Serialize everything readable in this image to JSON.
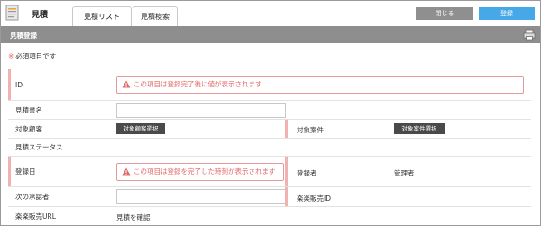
{
  "header": {
    "app_title": "見積",
    "tabs": [
      {
        "label": "見積リスト"
      },
      {
        "label": "見積検索"
      }
    ],
    "close_label": "閉じる",
    "register_label": "登録"
  },
  "section": {
    "title": "見積登録"
  },
  "required_note": "必須項目です",
  "required_mark": "※",
  "form": {
    "id_label": "ID",
    "id_notice": "この項目は登録完了後に値が表示されます",
    "name_label": "見積書名",
    "name_value": "",
    "customer_label": "対象顧客",
    "customer_button": "対象顧客選択",
    "case_label": "対象案件",
    "case_button": "対象案件選択",
    "status_label": "見積ステータス",
    "regdate_label": "登録日",
    "regdate_notice": "この項目は登録を完了した時刻が表示されます",
    "registrant_label": "登録者",
    "registrant_value": "管理者",
    "approver_label": "次の承認者",
    "approver_value": "",
    "rakuraku_id_label": "楽楽販売ID",
    "rakuraku_url_label": "楽楽販売URL",
    "rakuraku_url_value": "見積を確認"
  },
  "colors": {
    "accent_blue": "#46a8e6",
    "close_gray": "#8f8f8f",
    "section_gray": "#8e8e8e",
    "required_pink": "#f2b1b1",
    "notice_red": "#e06b6b"
  }
}
